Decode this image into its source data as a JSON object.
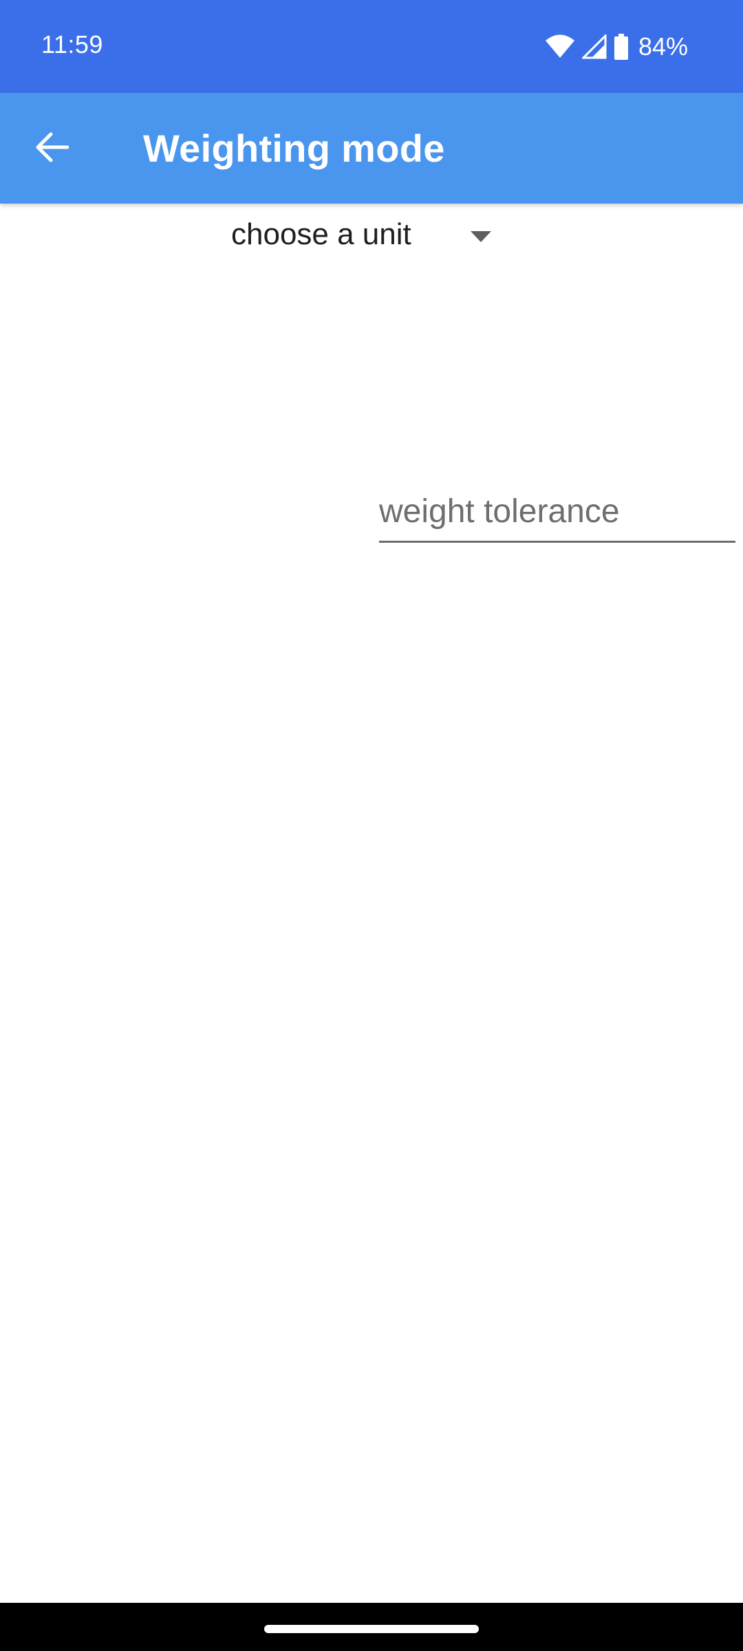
{
  "status_bar": {
    "time": "11:59",
    "battery": "84%"
  },
  "app_bar": {
    "title": "Weighting mode",
    "back_icon": "arrow-back-icon"
  },
  "unit_spinner": {
    "selected": "choose a unit",
    "icon": "dropdown-arrow-icon"
  },
  "tolerance_field": {
    "value": "",
    "placeholder": "weight tolerance"
  },
  "colors": {
    "status_bar": "#3b6fea",
    "app_bar": "#4a96ee",
    "background": "#ffffff",
    "nav_bar": "#000000"
  }
}
